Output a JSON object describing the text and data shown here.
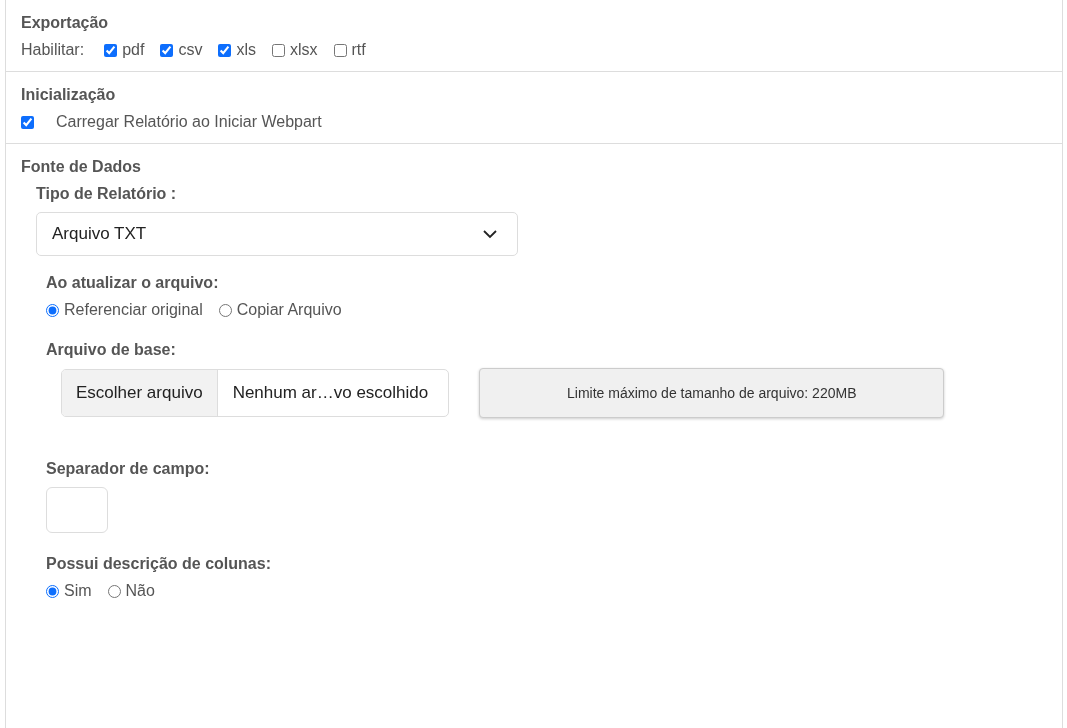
{
  "export": {
    "title": "Exportação",
    "label": "Habilitar:",
    "formats": [
      {
        "label": "pdf",
        "checked": true
      },
      {
        "label": "csv",
        "checked": true
      },
      {
        "label": "xls",
        "checked": true
      },
      {
        "label": "xlsx",
        "checked": false
      },
      {
        "label": "rtf",
        "checked": false
      }
    ]
  },
  "initialization": {
    "title": "Inicialização",
    "options": [
      {
        "label": "Carregar Relatório ao Iniciar Webpart",
        "checked": true
      }
    ]
  },
  "data_source": {
    "title": "Fonte de Dados",
    "report_type": {
      "label": "Tipo de Relatório :",
      "value": "Arquivo TXT"
    },
    "on_update": {
      "label": "Ao atualizar o arquivo:",
      "options": [
        {
          "label": "Referenciar original",
          "selected": true
        },
        {
          "label": "Copiar Arquivo",
          "selected": false
        }
      ]
    },
    "base_file": {
      "label": "Arquivo de base:",
      "button": "Escolher arquivo",
      "filename": "Nenhum ar…vo escolhido",
      "limit": "Limite máximo de tamanho de arquivo: 220MB"
    },
    "separator": {
      "label": "Separador de campo:"
    },
    "column_description": {
      "label": "Possui descrição de colunas:",
      "options": [
        {
          "label": "Sim",
          "selected": true
        },
        {
          "label": "Não",
          "selected": false
        }
      ]
    }
  }
}
